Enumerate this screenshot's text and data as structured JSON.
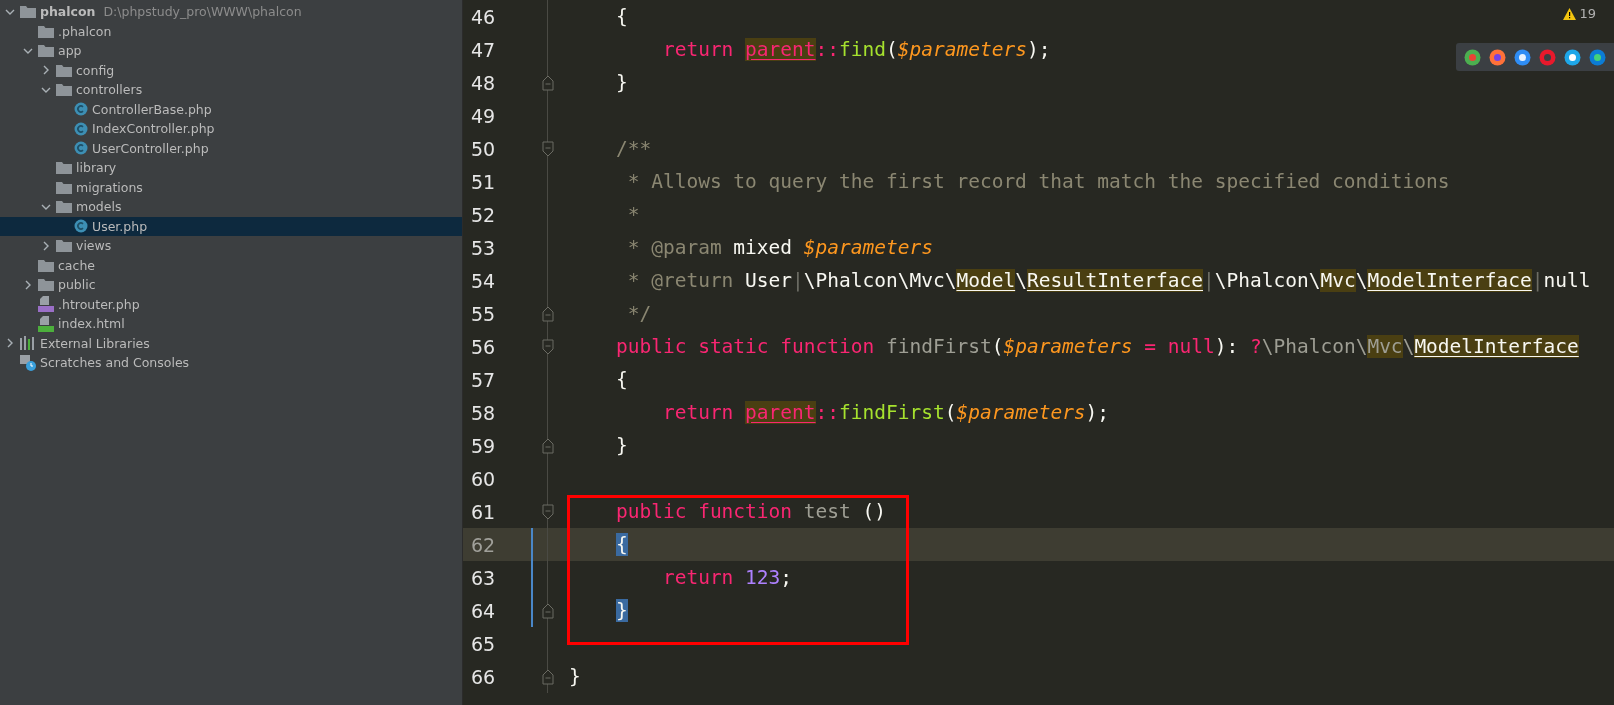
{
  "project_tree": {
    "items": [
      {
        "label": "phalcon",
        "path": "D:\\phpstudy_pro\\WWW\\phalcon",
        "kind": "folder",
        "expanded": true,
        "selected": false,
        "children": [
          {
            "label": ".phalcon",
            "kind": "folder",
            "selected": false
          },
          {
            "label": "app",
            "kind": "folder",
            "expanded": true,
            "selected": false,
            "children": [
              {
                "label": "config",
                "kind": "folder",
                "expanded": false,
                "selected": false
              },
              {
                "label": "controllers",
                "kind": "folder",
                "expanded": true,
                "selected": false,
                "children": [
                  {
                    "label": "ControllerBase.php",
                    "kind": "class",
                    "selected": false
                  },
                  {
                    "label": "IndexController.php",
                    "kind": "class",
                    "selected": false
                  },
                  {
                    "label": "UserController.php",
                    "kind": "class",
                    "selected": false
                  }
                ]
              },
              {
                "label": "library",
                "kind": "folder",
                "selected": false
              },
              {
                "label": "migrations",
                "kind": "folder",
                "selected": false
              },
              {
                "label": "models",
                "kind": "folder",
                "expanded": true,
                "selected": false,
                "children": [
                  {
                    "label": "User.php",
                    "kind": "class",
                    "selected": true
                  }
                ]
              },
              {
                "label": "views",
                "kind": "folder",
                "expanded": false,
                "selected": false
              }
            ]
          },
          {
            "label": "cache",
            "kind": "folder",
            "selected": false
          },
          {
            "label": "public",
            "kind": "folder",
            "expanded": false,
            "selected": false
          },
          {
            "label": ".htrouter.php",
            "kind": "php",
            "selected": false
          },
          {
            "label": "index.html",
            "kind": "html",
            "selected": false
          }
        ]
      },
      {
        "label": "External Libraries",
        "kind": "libraries",
        "expanded": false,
        "selected": false
      },
      {
        "label": "Scratches and Consoles",
        "kind": "scratches",
        "selected": false
      }
    ]
  },
  "editor": {
    "warnings": "19",
    "browsers": [
      {
        "kind": "chrome"
      },
      {
        "kind": "firefox"
      },
      {
        "kind": "safari"
      },
      {
        "kind": "opera"
      },
      {
        "kind": "ie"
      },
      {
        "kind": "edge"
      }
    ],
    "lines": [
      {
        "number": "46",
        "tokens": [
          {
            "text": "    {",
            "kind": "text"
          }
        ]
      },
      {
        "number": "47",
        "tokens": [
          {
            "text": "        return ",
            "kind": "kw"
          },
          {
            "text": "parent",
            "kind": "kw",
            "highlight": true,
            "underline": true
          },
          {
            "text": "::",
            "kind": "kw"
          },
          {
            "text": "find",
            "kind": "fn"
          },
          {
            "text": "(",
            "kind": "text"
          },
          {
            "text": "$parameters",
            "kind": "var"
          },
          {
            "text": ");",
            "kind": "text"
          }
        ]
      },
      {
        "number": "48",
        "fold_end": true,
        "tokens": [
          {
            "text": "    }",
            "kind": "text"
          }
        ]
      },
      {
        "number": "49"
      },
      {
        "number": "50",
        "fold_start": true,
        "tokens": [
          {
            "text": "    /**",
            "kind": "comment"
          }
        ]
      },
      {
        "number": "51",
        "tokens": [
          {
            "text": "     * Allows to query the first record that match the specified conditions",
            "kind": "comment"
          }
        ]
      },
      {
        "number": "52",
        "tokens": [
          {
            "text": "     *",
            "kind": "comment"
          }
        ]
      },
      {
        "number": "53",
        "tokens": [
          {
            "text": "     * @param",
            "kind": "comment"
          },
          {
            "text": " mixed ",
            "kind": "text"
          },
          {
            "text": "$parameters",
            "kind": "var"
          }
        ]
      },
      {
        "number": "54",
        "tokens": [
          {
            "text": "     * @return",
            "kind": "comment"
          },
          {
            "text": " User",
            "kind": "text"
          },
          {
            "text": "|",
            "kind": "pipe"
          },
          {
            "text": "\\Phalcon\\Mvc\\",
            "kind": "text"
          },
          {
            "text": "Model",
            "kind": "text",
            "highlight": true,
            "underline": true
          },
          {
            "text": "\\",
            "kind": "text"
          },
          {
            "text": "ResultInterface",
            "kind": "text",
            "highlight": true,
            "underline": true
          },
          {
            "text": "|",
            "kind": "pipe"
          },
          {
            "text": "\\Phalcon\\",
            "kind": "text"
          },
          {
            "text": "Mvc",
            "kind": "text",
            "highlight": true
          },
          {
            "text": "\\",
            "kind": "text"
          },
          {
            "text": "ModelInterface",
            "kind": "text",
            "highlight": true,
            "underline": true
          },
          {
            "text": "|",
            "kind": "pipe"
          },
          {
            "text": "null",
            "kind": "text"
          }
        ]
      },
      {
        "number": "55",
        "fold_end": true,
        "tokens": [
          {
            "text": "     */",
            "kind": "comment"
          }
        ]
      },
      {
        "number": "56",
        "fold_start": true,
        "tokens": [
          {
            "text": "    public static function ",
            "kind": "kw"
          },
          {
            "text": "findFirst",
            "kind": "dim"
          },
          {
            "text": "(",
            "kind": "text"
          },
          {
            "text": "$parameters",
            "kind": "var"
          },
          {
            "text": " = null",
            "kind": "kw"
          },
          {
            "text": "): ",
            "kind": "text"
          },
          {
            "text": "?",
            "kind": "kw"
          },
          {
            "text": "\\Phalcon\\",
            "kind": "dim"
          },
          {
            "text": "Mvc",
            "kind": "dim",
            "highlight": true
          },
          {
            "text": "\\",
            "kind": "dim"
          },
          {
            "text": "ModelInterface",
            "kind": "text",
            "highlight": true,
            "underline": true
          }
        ]
      },
      {
        "number": "57",
        "tokens": [
          {
            "text": "    {",
            "kind": "text"
          }
        ]
      },
      {
        "number": "58",
        "tokens": [
          {
            "text": "        return ",
            "kind": "kw"
          },
          {
            "text": "parent",
            "kind": "kw",
            "highlight": true,
            "underline": true
          },
          {
            "text": "::",
            "kind": "kw"
          },
          {
            "text": "findFirst",
            "kind": "fn"
          },
          {
            "text": "(",
            "kind": "text"
          },
          {
            "text": "$parameters",
            "kind": "var"
          },
          {
            "text": ");",
            "kind": "text"
          }
        ]
      },
      {
        "number": "59",
        "fold_end": true,
        "tokens": [
          {
            "text": "    }",
            "kind": "text"
          }
        ]
      },
      {
        "number": "60"
      },
      {
        "number": "61",
        "fold_start": true,
        "framed": true,
        "tokens": [
          {
            "text": "    public function ",
            "kind": "kw"
          },
          {
            "text": "test",
            "kind": "dim"
          },
          {
            "text": " ()",
            "kind": "text"
          }
        ]
      },
      {
        "number": "62",
        "current": true,
        "changed": true,
        "framed": true,
        "tokens": [
          {
            "text": "    {",
            "kind": "text",
            "matched": true
          }
        ]
      },
      {
        "number": "63",
        "changed": true,
        "framed": true,
        "tokens": [
          {
            "text": "        return ",
            "kind": "kw"
          },
          {
            "text": "123",
            "kind": "num"
          },
          {
            "text": ";",
            "kind": "text"
          }
        ]
      },
      {
        "number": "64",
        "fold_end": true,
        "changed": true,
        "framed": true,
        "tokens": [
          {
            "text": "    }",
            "kind": "text",
            "matched": true
          }
        ]
      },
      {
        "number": "65"
      },
      {
        "number": "66",
        "fold_end": true,
        "tokens": [
          {
            "text": "}",
            "kind": "text"
          }
        ]
      }
    ]
  }
}
